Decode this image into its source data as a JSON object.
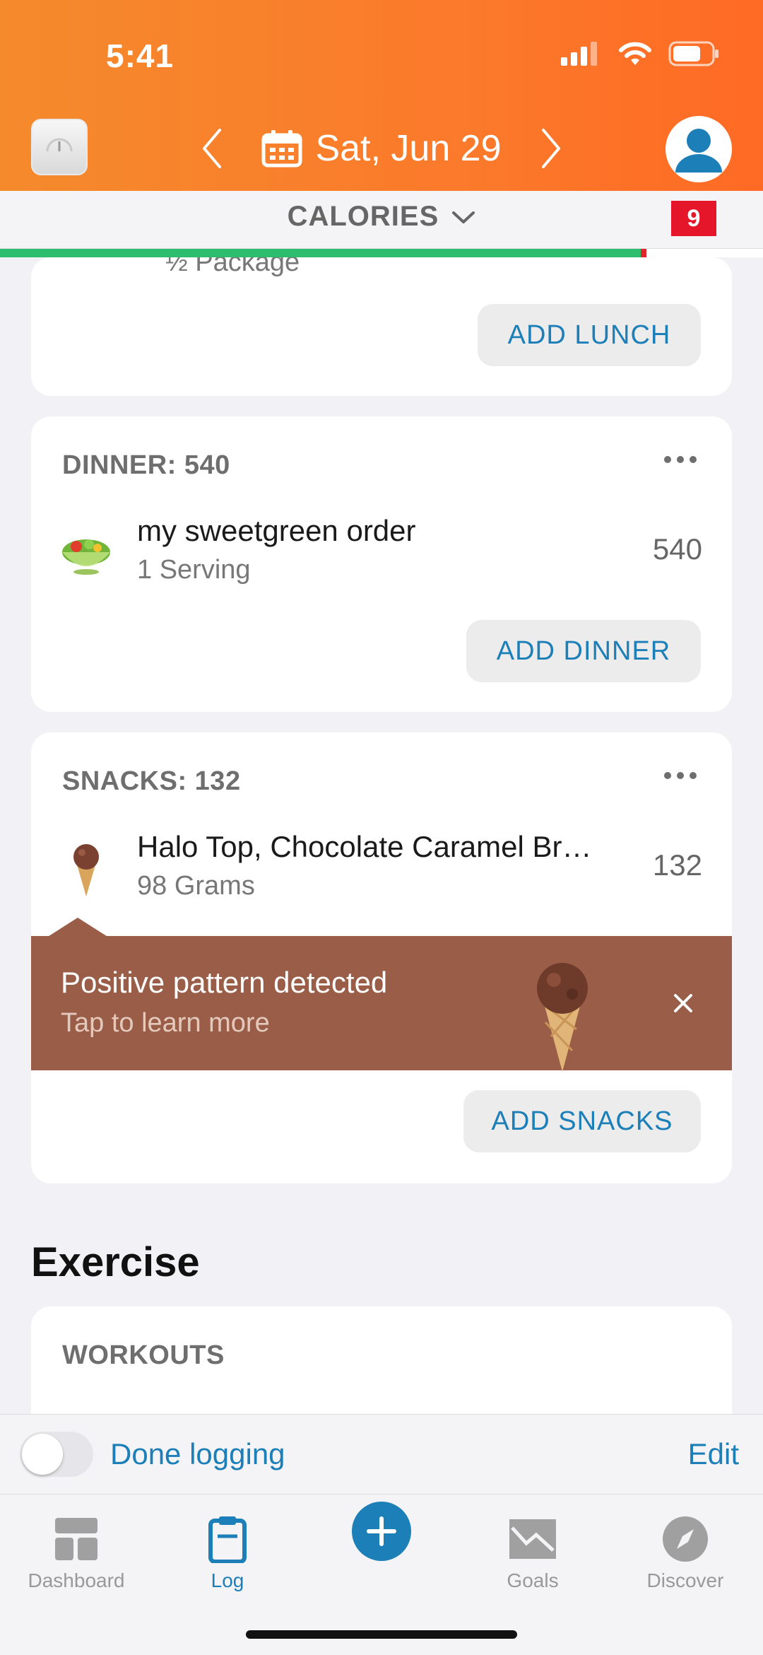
{
  "status_bar": {
    "time": "5:41"
  },
  "header": {
    "date": "Sat, Jun 29"
  },
  "calories_strip": {
    "label": "CALORIES",
    "badge": "9",
    "progress_fraction": 0.84
  },
  "lunch": {
    "partial_item_text": "½ Package",
    "add_label": "ADD LUNCH"
  },
  "dinner": {
    "title": "DINNER: 540",
    "items": [
      {
        "name": "my sweetgreen order",
        "qty": "1 Serving",
        "calories": "540"
      }
    ],
    "add_label": "ADD DINNER"
  },
  "snacks": {
    "title": "SNACKS: 132",
    "items": [
      {
        "name": "Halo Top, Chocolate Caramel Br…",
        "qty": "98 Grams",
        "calories": "132"
      }
    ],
    "add_label": "ADD SNACKS"
  },
  "insight": {
    "title": "Positive pattern detected",
    "subtitle": "Tap to learn more"
  },
  "exercise": {
    "section_title": "Exercise",
    "workouts_title": "WORKOUTS"
  },
  "done_bar": {
    "done_label": "Done logging",
    "edit_label": "Edit"
  },
  "tabs": [
    {
      "label": "Dashboard",
      "icon": "dashboard-icon"
    },
    {
      "label": "Log",
      "icon": "log-clipboard-icon"
    },
    {
      "label": "",
      "icon": "plus-icon"
    },
    {
      "label": "Goals",
      "icon": "goals-chart-icon"
    },
    {
      "label": "Discover",
      "icon": "compass-icon"
    }
  ],
  "colors": {
    "header_orange": "#f58a2c",
    "accent_blue": "#1d7fb8",
    "insight_brown": "#9a5d47",
    "progress_green": "#2dbd6e",
    "over_red": "#e0252b"
  }
}
